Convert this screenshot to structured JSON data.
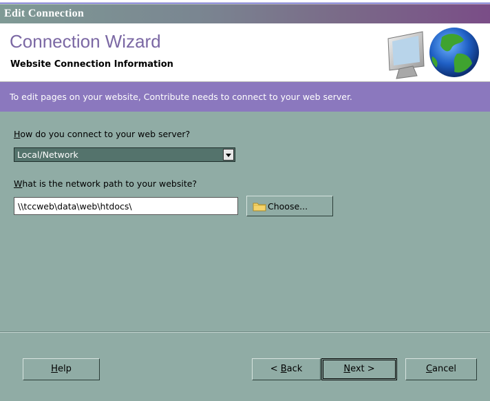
{
  "window": {
    "title": "Edit Connection"
  },
  "header": {
    "wizard_title": "Connection Wizard",
    "subtitle": "Website Connection Information"
  },
  "banner": {
    "text": "To edit pages on your website, Contribute needs to connect to your web server."
  },
  "connect_method": {
    "question_prefix": "H",
    "question_rest": "ow do you connect to your web server?",
    "selected": "Local/Network"
  },
  "network_path": {
    "question_prefix": "W",
    "question_rest": "hat is the network path to your website?",
    "value": "\\\\tccweb\\data\\web\\htdocs\\",
    "choose_label": "Choose..."
  },
  "buttons": {
    "help_prefix": "H",
    "help_rest": "elp",
    "back_before": "< ",
    "back_prefix": "B",
    "back_rest": "ack",
    "next_prefix": "N",
    "next_rest": "ext >",
    "cancel_prefix": "C",
    "cancel_rest": "ancel"
  },
  "colors": {
    "dialog_bg": "#90aca5",
    "banner": "#8b78be",
    "title_text": "#7b68a4"
  },
  "icons": [
    "monitor-globe-icon",
    "folder-icon",
    "dropdown-arrow-icon"
  ]
}
